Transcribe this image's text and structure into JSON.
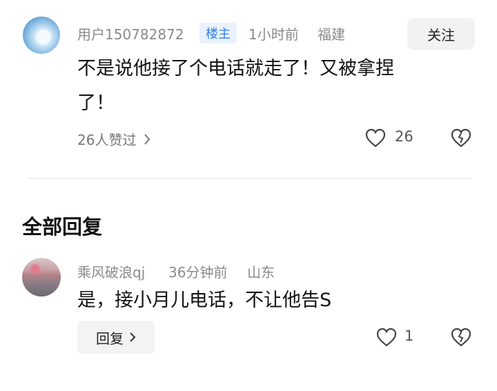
{
  "post": {
    "username": "用户150782872",
    "badge": "楼主",
    "time": "1小时前",
    "location": "福建",
    "follow_label": "关注",
    "comment_line1": "不是说他接了个电话就走了！又被拿捏",
    "comment_line2": "了！",
    "liked_by_text": "26人赞过",
    "like_count": "26"
  },
  "replies_section": {
    "title": "全部回复"
  },
  "reply": {
    "username": "乘风破浪qj",
    "time": "36分钟前",
    "location": "山东",
    "text": "是，接小月儿电话，不让他告S",
    "reply_button_label": "回复",
    "like_count": "1"
  },
  "colors": {
    "badge_blue": "#2f7de1",
    "badge_bg": "#e9f2fd",
    "muted": "#8a8a8a"
  },
  "icons": [
    "heart-icon",
    "broken-heart-icon",
    "chevron-right-icon"
  ]
}
